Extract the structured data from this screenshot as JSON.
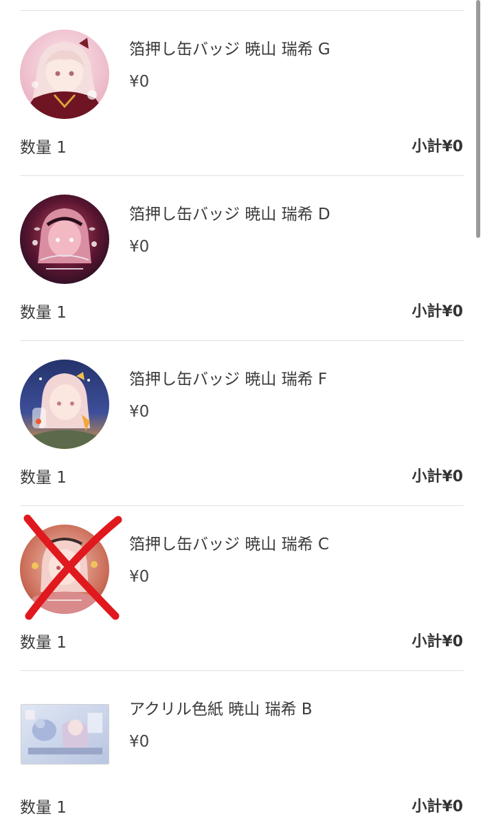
{
  "items": [
    {
      "name": "箔押し缶バッジ 暁山 瑞希 G",
      "price": "¥0",
      "quantity": "数量 1",
      "subtotal": "小計¥0",
      "thumb_shape": "circle",
      "crossed_out": false
    },
    {
      "name": "箔押し缶バッジ 暁山 瑞希 D",
      "price": "¥0",
      "quantity": "数量 1",
      "subtotal": "小計¥0",
      "thumb_shape": "circle",
      "crossed_out": false
    },
    {
      "name": "箔押し缶バッジ 暁山 瑞希 F",
      "price": "¥0",
      "quantity": "数量 1",
      "subtotal": "小計¥0",
      "thumb_shape": "circle",
      "crossed_out": false
    },
    {
      "name": "箔押し缶バッジ 暁山 瑞希 C",
      "price": "¥0",
      "quantity": "数量 1",
      "subtotal": "小計¥0",
      "thumb_shape": "circle",
      "crossed_out": true
    },
    {
      "name": "アクリル色紙 暁山 瑞希 B",
      "price": "¥0",
      "quantity": "数量 1",
      "subtotal": "小計¥0",
      "thumb_shape": "rectangle",
      "crossed_out": false
    }
  ],
  "colors": {
    "text": "#3a3a3a",
    "divider": "#e0e0e0",
    "cross_mark": "#e0191f"
  }
}
